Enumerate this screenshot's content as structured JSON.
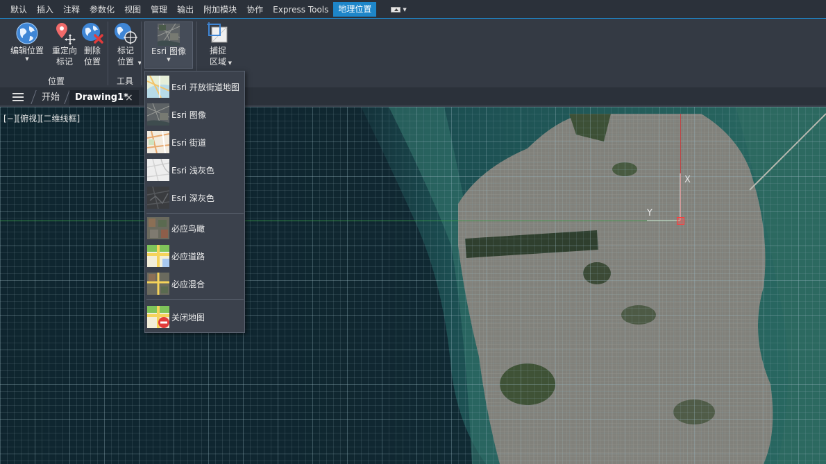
{
  "ribbon": {
    "tabs": [
      {
        "label": "默认"
      },
      {
        "label": "插入"
      },
      {
        "label": "注释"
      },
      {
        "label": "参数化"
      },
      {
        "label": "视图"
      },
      {
        "label": "管理"
      },
      {
        "label": "输出"
      },
      {
        "label": "附加模块"
      },
      {
        "label": "协作"
      },
      {
        "label": "Express Tools"
      },
      {
        "label": "地理位置"
      }
    ],
    "active_tab": "地理位置",
    "groups": {
      "location": {
        "label": "位置",
        "buttons": {
          "edit_location": "编辑位置",
          "reorient_marker": "重定向\n标记",
          "remove_location": "删除\n位置"
        }
      },
      "tools": {
        "label": "工具",
        "buttons": {
          "mark_position": "标记\n位置"
        }
      },
      "online_map": {
        "buttons": {
          "esri_imagery": "Esri 图像"
        }
      },
      "capture": {
        "buttons": {
          "capture_area": "捕捉\n区域"
        }
      }
    }
  },
  "doc_tabs": {
    "start": "开始",
    "drawing": "Drawing1*",
    "close_glyph": "×"
  },
  "viewport": {
    "label": "[−][俯视][二维线框]"
  },
  "map_menu": {
    "items": [
      {
        "label": "Esri 开放街道地图",
        "thumb": "osm"
      },
      {
        "label": "Esri 图像",
        "thumb": "imagery"
      },
      {
        "label": "Esri 街道",
        "thumb": "streets"
      },
      {
        "label": "Esri 浅灰色",
        "thumb": "light-gray"
      },
      {
        "label": "Esri 深灰色",
        "thumb": "dark-gray"
      },
      {
        "label": "必应鸟瞰",
        "thumb": "bing-aerial"
      },
      {
        "label": "必应道路",
        "thumb": "bing-road"
      },
      {
        "label": "必应混合",
        "thumb": "bing-hybrid"
      },
      {
        "label": "关闭地图",
        "thumb": "map-off"
      }
    ]
  },
  "colors": {
    "accent": "#1e86c9",
    "ribbon_bg": "#343a44",
    "water": "#1f5a5a",
    "land": "#7d7f76",
    "ucs_x": "#3aa14a",
    "ucs_y": "#c93a3a"
  },
  "ucs": {
    "x_label": "X",
    "y_label": "Y"
  }
}
